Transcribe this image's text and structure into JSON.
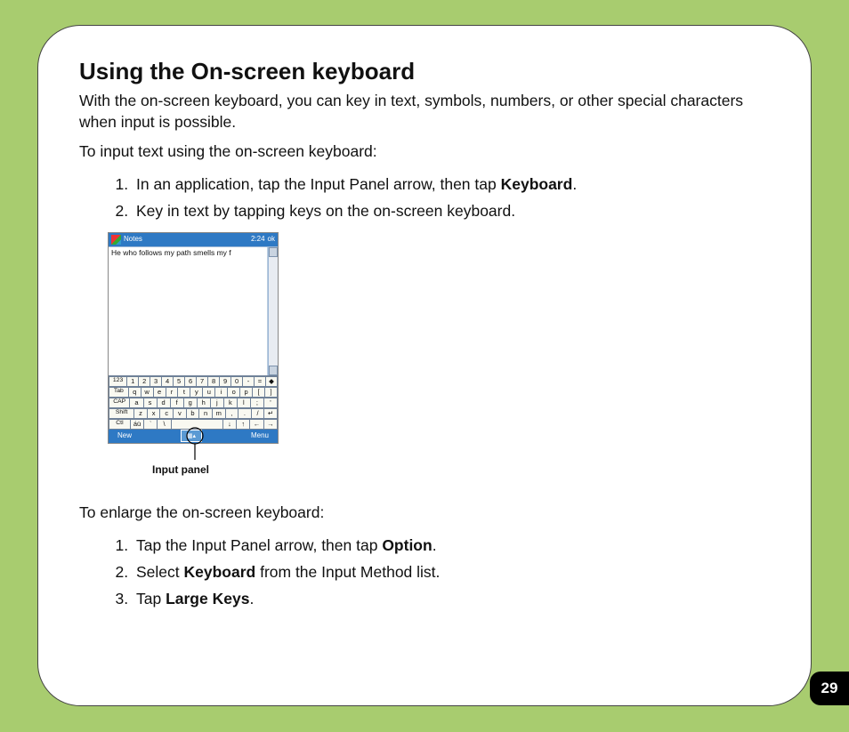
{
  "page_number": "29",
  "title": "Using the On-screen keyboard",
  "intro": "With the on-screen keyboard, you can key in text, symbols, numbers, or other special characters when input is possible.",
  "lead_in_1": "To input text using the on-screen keyboard:",
  "steps_1": {
    "s1_pre": "In an application, tap the Input Panel arrow, then tap ",
    "s1_bold": "Keyboard",
    "s1_post": ".",
    "s2": "Key in text by tapping keys on the on-screen keyboard."
  },
  "figure": {
    "app_title": "Notes",
    "status_right": "2:24",
    "status_ok": "ok",
    "typed_text": "He who follows my path smells my f",
    "bottom_left": "New",
    "bottom_right": "Menu",
    "callout_label": "Input panel",
    "kb": {
      "r1": [
        "123",
        "1",
        "2",
        "3",
        "4",
        "5",
        "6",
        "7",
        "8",
        "9",
        "0",
        "-",
        "=",
        "◆"
      ],
      "r2": [
        "Tab",
        "q",
        "w",
        "e",
        "r",
        "t",
        "y",
        "u",
        "i",
        "o",
        "p",
        "[",
        "]"
      ],
      "r3": [
        "CAP",
        "a",
        "s",
        "d",
        "f",
        "g",
        "h",
        "j",
        "k",
        "l",
        ";",
        "'"
      ],
      "r4": [
        "Shift",
        "z",
        "x",
        "c",
        "v",
        "b",
        "n",
        "m",
        ",",
        ".",
        "/",
        "↵"
      ],
      "r5": [
        "Ctl",
        "áü",
        "`",
        "\\",
        " ",
        " ",
        " ",
        " ",
        "↓",
        "↑",
        "←",
        "→"
      ]
    }
  },
  "lead_in_2": "To enlarge the on-screen keyboard:",
  "steps_2": {
    "s1_pre": "Tap the Input Panel arrow, then tap ",
    "s1_bold": "Option",
    "s1_post": ".",
    "s2_pre": "Select ",
    "s2_bold": "Keyboard",
    "s2_post": " from the Input Method list.",
    "s3_pre": "Tap ",
    "s3_bold": "Large Keys",
    "s3_post": "."
  }
}
